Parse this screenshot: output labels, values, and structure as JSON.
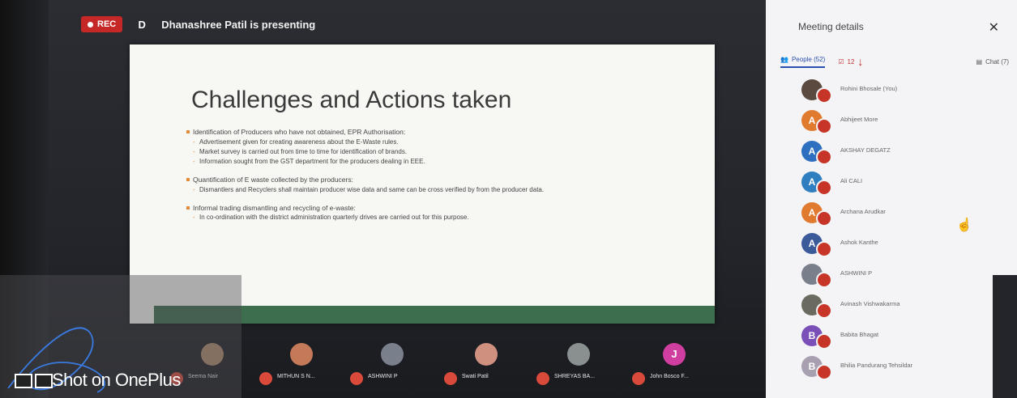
{
  "recording": {
    "label": "REC"
  },
  "presenter": {
    "initial": "D",
    "text": "Dhanashree Patil is presenting"
  },
  "slide": {
    "title": "Challenges and Actions taken",
    "sections": [
      {
        "heading": "Identification of Producers who have not obtained, EPR Authorisation:",
        "items": [
          "Advertisement given for creating awareness about the E-Waste rules.",
          "Market survey is carried out from time to time for identification of brands.",
          "Information sought from the GST department for the producers dealing in EEE."
        ]
      },
      {
        "heading": "Quantification of E waste collected by the producers:",
        "items": [
          "Dismantlers and Recyclers shall maintain producer wise data and same can be cross verified by from the producer data."
        ]
      },
      {
        "heading": "Informal trading dismantling and recycling of e-waste:",
        "items": [
          "In co-ordination with the district administration quarterly drives are carried out for this purpose."
        ]
      }
    ]
  },
  "thumbnails": [
    {
      "name": "Seema Nair",
      "color": "#b08a6a"
    },
    {
      "name": "MITHUN S N...",
      "color": "#c47a58"
    },
    {
      "name": "ASHWINI P",
      "color": "#7a7f8c"
    },
    {
      "name": "Swati Patil",
      "color": "#d09080"
    },
    {
      "name": "SHREYAS BA...",
      "color": "#8a8f90"
    },
    {
      "name": "John Bosco F...",
      "color": "#d03fa0",
      "initial": "J"
    }
  ],
  "panel": {
    "title": "Meeting details",
    "tabs": {
      "people": "People (52)",
      "tasks_count": "12",
      "chat": "Chat (7)"
    },
    "people": [
      {
        "name": "Rohini Bhosale (You)",
        "initial": "",
        "color": "#5a4a40"
      },
      {
        "name": "Abhijeet More",
        "initial": "A",
        "color": "#e07a2e"
      },
      {
        "name": "AKSHAY DEGATZ",
        "initial": "A",
        "color": "#2f6fc0"
      },
      {
        "name": "Ali CALI",
        "initial": "A",
        "color": "#2f7fc0"
      },
      {
        "name": "Archana Arudkar",
        "initial": "A",
        "color": "#e07a2e"
      },
      {
        "name": "Ashok Kanthe",
        "initial": "A",
        "color": "#3a5a9a"
      },
      {
        "name": "ASHWINI P",
        "initial": "",
        "color": "#7a7f8c"
      },
      {
        "name": "Avinash Vishwakarma",
        "initial": "",
        "color": "#6a6a60"
      },
      {
        "name": "Babita Bhagat",
        "initial": "B",
        "color": "#7a4fb8"
      },
      {
        "name": "Bhilia Pandurang Tehsildar",
        "initial": "B",
        "color": "#a8a0b0"
      }
    ]
  },
  "watermark": {
    "text": "Shot on OnePlus"
  }
}
